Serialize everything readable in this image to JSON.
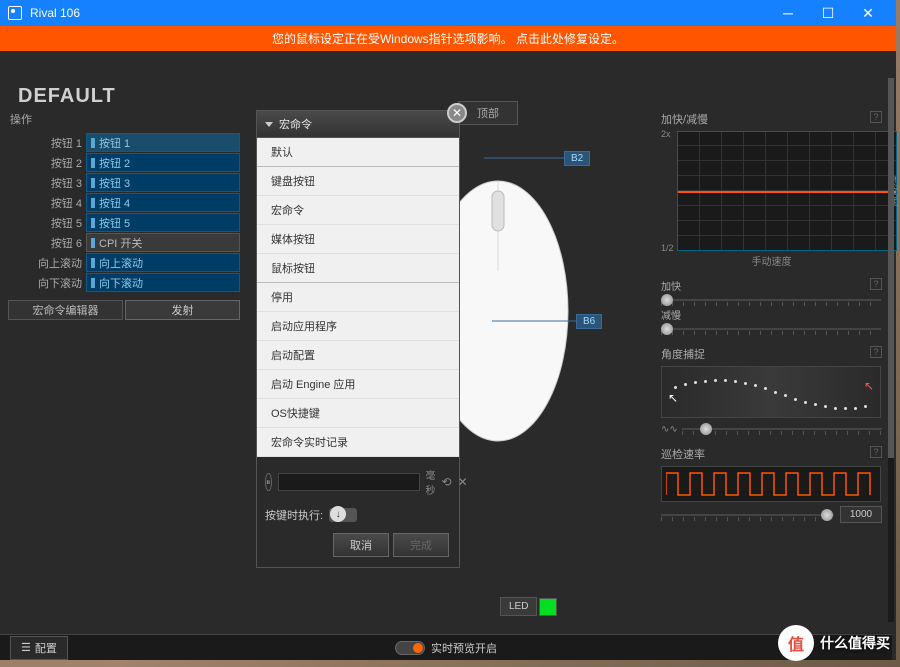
{
  "titlebar": {
    "title": "Rival 106"
  },
  "warning": {
    "text": "您的鼠标设定正在受Windows指针选项影响。 点击此处修复设定。"
  },
  "profile": {
    "name": "DEFAULT"
  },
  "ops": {
    "label": "操作",
    "rows": [
      {
        "label": "按钮 1",
        "value": "按钮 1"
      },
      {
        "label": "按钮 2",
        "value": "按钮 2"
      },
      {
        "label": "按钮 3",
        "value": "按钮 3"
      },
      {
        "label": "按钮 4",
        "value": "按钮 4"
      },
      {
        "label": "按钮 5",
        "value": "按钮 5"
      },
      {
        "label": "按钮 6",
        "value": "CPI 开关"
      },
      {
        "label": "向上滚动",
        "value": "向上滚动"
      },
      {
        "label": "向下滚动",
        "value": "向下滚动"
      }
    ],
    "macro_editor": "宏命令编辑器",
    "fire": "发射"
  },
  "center": {
    "top_tab": "顶部",
    "tags": {
      "b2": "B2",
      "b6": "B6"
    },
    "led": "LED"
  },
  "dropdown": {
    "header": "宏命令",
    "items": [
      "默认",
      "键盘按钮",
      "宏命令",
      "媒体按钮",
      "鼠标按钮",
      "停用",
      "启动应用程序",
      "启动配置",
      "启动 Engine 应用",
      "OS快捷键",
      "宏命令实时记录"
    ],
    "ms": "毫秒",
    "exec_label": "按键时执行:",
    "cancel": "取消",
    "done": "完成"
  },
  "right": {
    "accel": {
      "title": "加快/减慢",
      "y_top": "2x",
      "y_bot": "1/2",
      "ylabel": "灵敏度",
      "xlabel": "手动速度"
    },
    "fast": "加快",
    "slow": "减慢",
    "angle": "角度捕捉",
    "poll": {
      "title": "巡检速率",
      "value": "1000"
    }
  },
  "bottom": {
    "config": "配置",
    "preview": "实时预览开启"
  },
  "watermark": {
    "icon": "值",
    "text": "什么值得买"
  },
  "chart_data": [
    {
      "type": "line",
      "title": "加快/减慢",
      "xlabel": "手动速度",
      "ylabel": "灵敏度",
      "ylim": [
        "1/2",
        "2x"
      ],
      "series": [
        {
          "name": "sensitivity",
          "values": [
            1,
            1,
            1,
            1,
            1,
            1,
            1,
            1,
            1,
            1
          ]
        }
      ]
    },
    {
      "type": "line",
      "title": "角度捕捉",
      "series": [
        {
          "name": "wave",
          "values": [
            0.5,
            0.2,
            0,
            0.1,
            0.4,
            0.7,
            0.9,
            1,
            0.9,
            0.7,
            0.4,
            0.1,
            0,
            0.2,
            0.5
          ]
        }
      ]
    },
    {
      "type": "line",
      "title": "巡检速率",
      "series": [
        {
          "name": "square",
          "values": [
            0,
            1,
            1,
            0,
            0,
            1,
            1,
            0,
            0,
            1,
            1,
            0,
            0,
            1,
            1,
            0,
            0,
            1,
            1,
            0,
            0,
            1,
            1,
            0,
            0,
            1,
            1,
            0,
            0,
            1,
            1,
            0
          ]
        }
      ]
    }
  ]
}
